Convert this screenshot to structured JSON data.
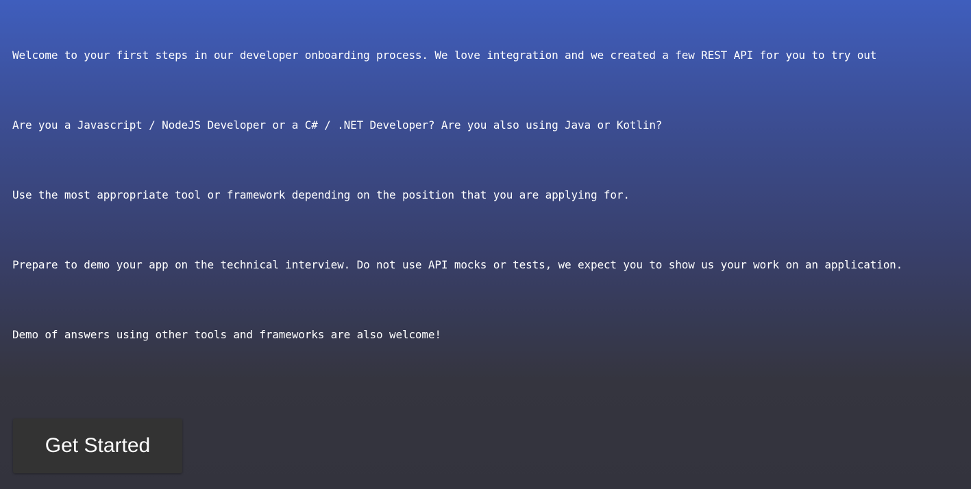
{
  "intro": {
    "paragraphs": [
      "Welcome to your first steps in our developer onboarding process. We love integration and we created a few REST API for you to try out",
      "Are you a Javascript / NodeJS Developer or a C# / .NET Developer? Are you also using Java or Kotlin?",
      "Use the most appropriate tool or framework depending on the position that you are applying for.",
      "Prepare to demo your app on the technical interview. Do not use API mocks or tests, we expect you to show us your work on an application.",
      "Demo of answers using other tools and frameworks are also welcome!"
    ]
  },
  "actions": {
    "get_started_label": "Get Started"
  },
  "colors": {
    "gradient_top": "#3f5ebd",
    "gradient_bottom": "#33333d",
    "text": "#ffffff",
    "button_bg": "#333333"
  }
}
